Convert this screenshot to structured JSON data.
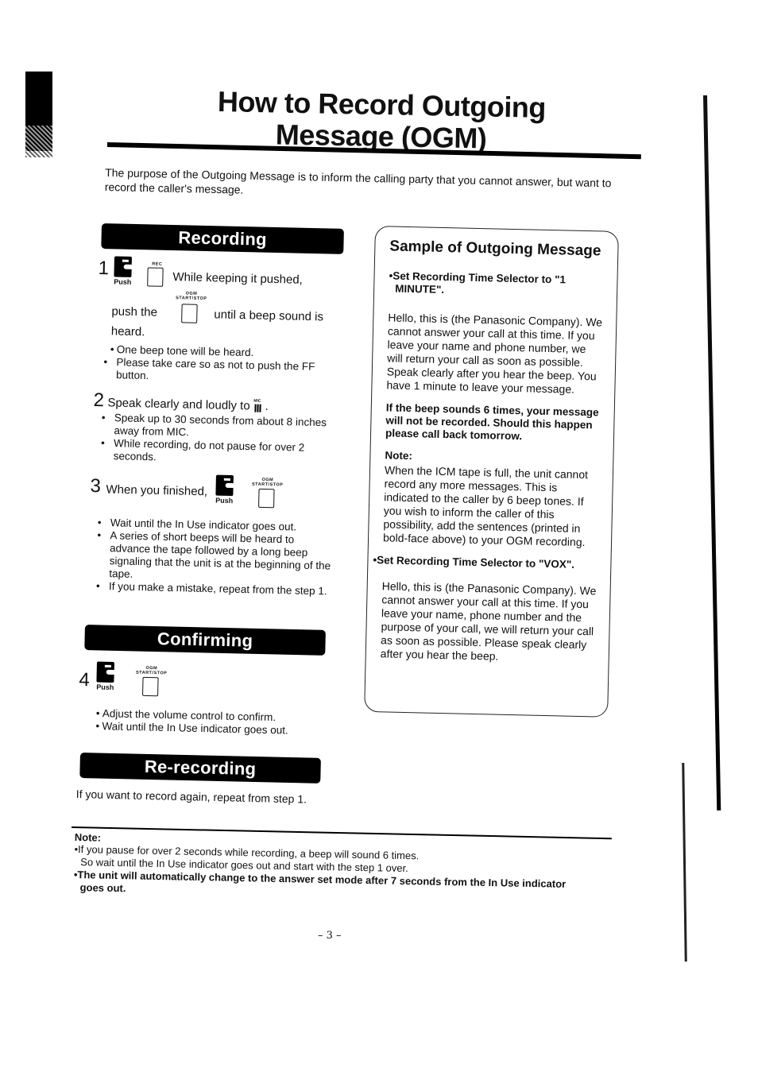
{
  "title_line1": "How to Record Outgoing",
  "title_line2": "Message (OGM)",
  "intro": "The purpose of the Outgoing Message is to inform the calling party that you cannot answer, but want to record the caller's message.",
  "icons": {
    "push_label": "Push",
    "rec_label": "REC",
    "ogm_label_top": "OGM",
    "ogm_label_bottom": "START/STOP",
    "mic_label": "MIC"
  },
  "recording": {
    "heading": "Recording",
    "step1": {
      "num": "1",
      "line1": "While keeping it pushed,",
      "line2_pre": "push the",
      "line2_post": "until a beep sound is",
      "line3": "heard.",
      "bullets": [
        "One beep tone will be heard.",
        "Please take care so as not to push the FF button."
      ]
    },
    "step2": {
      "num": "2",
      "text": "Speak clearly and loudly to",
      "bullets": [
        "Speak up to 30 seconds from about 8 inches away from MIC.",
        "While recording, do not pause for over 2 seconds."
      ]
    },
    "step3": {
      "num": "3",
      "text": "When you finished,",
      "bullets": [
        "Wait until the In Use indicator goes out.",
        "A series of short beeps will be heard to advance the tape followed by a long beep signaling that the unit is at the beginning of the tape.",
        "If you make a mistake, repeat from the step 1."
      ]
    }
  },
  "confirming": {
    "heading": "Confirming",
    "step4": {
      "num": "4",
      "bullets": [
        "Adjust the volume control to confirm.",
        "Wait until the In Use indicator goes out."
      ]
    }
  },
  "rerecording": {
    "heading": "Re-recording",
    "text": "If you want to record again, repeat from step 1."
  },
  "sample": {
    "heading": "Sample of Outgoing Message",
    "set1": "Set Recording Time Selector to \"1 MINUTE\".",
    "msg1": "Hello, this is (the Panasonic Company). We cannot answer your call at this time. If you leave your name and phone number, we will return your call as soon as possible. Speak clearly after you hear the beep. You have 1 minute to leave your message.",
    "bold_msg": "If the beep sounds 6 times, your message will not be recorded. Should this happen please call back tomorrow.",
    "note_label": "Note:",
    "note_text": "When the ICM tape is full, the unit cannot record any more messages. This is indicated to the caller by 6 beep tones. If you wish to inform the caller of this possibility, add the sentences (printed in bold-face above) to your OGM recording.",
    "set2": "Set Recording Time Selector to \"VOX\".",
    "msg2": "Hello, this is (the Panasonic Company). We cannot answer your call at this time. If you leave your name, phone number and the purpose of your call, we will return your call as soon as possible. Please speak clearly after you hear the beep."
  },
  "bottom_note": {
    "label": "Note:",
    "item1_line1": "If you pause for over 2 seconds while recording, a beep will sound 6 times.",
    "item1_line2": "So wait until the In Use indicator goes out and start with the step 1 over.",
    "item2": "The unit will automatically change to the answer set mode after 7 seconds from the In Use indicator goes out."
  },
  "page_number": "– 3 –"
}
